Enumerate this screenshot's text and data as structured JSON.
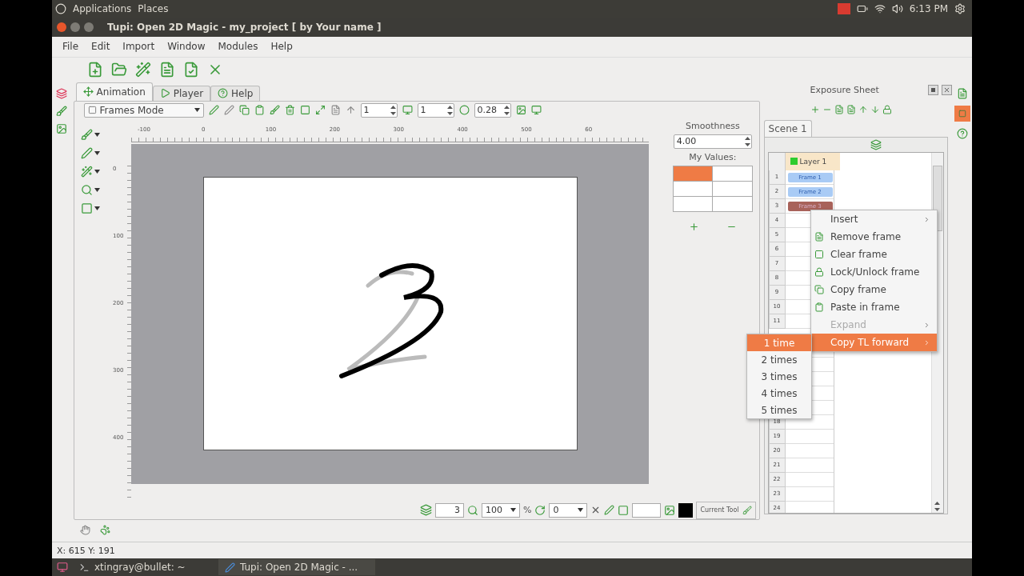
{
  "top_panel": {
    "menus": [
      "Applications",
      "Places"
    ],
    "clock": "6:13 PM"
  },
  "window": {
    "title": "Tupi: Open 2D Magic - my_project [ by Your name ]"
  },
  "menu_bar": [
    "File",
    "Edit",
    "Import",
    "Window",
    "Modules",
    "Help"
  ],
  "tabs": [
    {
      "label": "Animation",
      "selected": true
    },
    {
      "label": "Player",
      "selected": false
    },
    {
      "label": "Help",
      "selected": false
    }
  ],
  "canvas_toolbar": {
    "mode": "Frames Mode",
    "spin_1": "1",
    "spin_2": "1",
    "spin_3": "0.28"
  },
  "ruler": {
    "horizontal": [
      "-100",
      "0",
      "100",
      "200",
      "300",
      "400",
      "500",
      "60"
    ],
    "vertical": [
      "0",
      "100",
      "200",
      "300",
      "400"
    ]
  },
  "side_pane": {
    "smoothness_label": "Smoothness",
    "smoothness": "4.00",
    "values_label": "My Values:",
    "cells": [
      {
        "selected": true
      },
      {
        "selected": false
      },
      {
        "selected": false
      },
      {
        "selected": false
      },
      {
        "selected": false
      },
      {
        "selected": false
      }
    ]
  },
  "bottom_toolbar": {
    "frame": "3",
    "zoom": "100",
    "zoom_unit": "%",
    "rotation": "0",
    "current_tool": "Current Tool"
  },
  "exposure_sheet": {
    "title": "Exposure Sheet",
    "scene_tab": "Scene 1",
    "layer": "Layer 1",
    "rows": [
      {
        "number": "1",
        "frame": "Frame 1",
        "selected": false
      },
      {
        "number": "2",
        "frame": "Frame 2",
        "selected": false
      },
      {
        "number": "3",
        "frame": "Frame 3",
        "selected": true
      },
      {
        "number": "4"
      },
      {
        "number": "5"
      },
      {
        "number": "6"
      },
      {
        "number": "7"
      },
      {
        "number": "8"
      },
      {
        "number": "9"
      },
      {
        "number": "10"
      },
      {
        "number": "11"
      },
      {},
      {},
      {},
      {},
      {},
      {},
      {
        "number": "18"
      },
      {
        "number": "19"
      },
      {
        "number": "20"
      },
      {
        "number": "21"
      },
      {
        "number": "22"
      },
      {
        "number": "23"
      },
      {
        "number": "24"
      }
    ]
  },
  "context_menu": [
    {
      "label": "Insert",
      "kind": "submenu",
      "disabled": false,
      "selected": false
    },
    {
      "label": "Remove frame",
      "kind": "remove",
      "disabled": false,
      "selected": false
    },
    {
      "label": "Clear frame",
      "kind": "clear",
      "disabled": false,
      "selected": false
    },
    {
      "label": "Lock/Unlock frame",
      "kind": "lock",
      "disabled": false,
      "selected": false
    },
    {
      "label": "Copy frame",
      "kind": "copy",
      "disabled": false,
      "selected": false
    },
    {
      "label": "Paste in frame",
      "kind": "paste",
      "disabled": false,
      "selected": false
    },
    {
      "label": "Expand",
      "kind": "submenu",
      "disabled": true,
      "selected": false
    },
    {
      "label": "Copy TL forward",
      "kind": "submenu",
      "disabled": false,
      "selected": true
    }
  ],
  "submenu": [
    {
      "label": "1 time",
      "selected": true
    },
    {
      "label": "2 times",
      "selected": false
    },
    {
      "label": "3 times",
      "selected": false
    },
    {
      "label": "4 times",
      "selected": false
    },
    {
      "label": "5 times",
      "selected": false
    }
  ],
  "status_bar": "X: 615 Y: 191",
  "taskbar": [
    "xtingray@bullet: ~",
    "Tupi: Open 2D Magic - ..."
  ]
}
